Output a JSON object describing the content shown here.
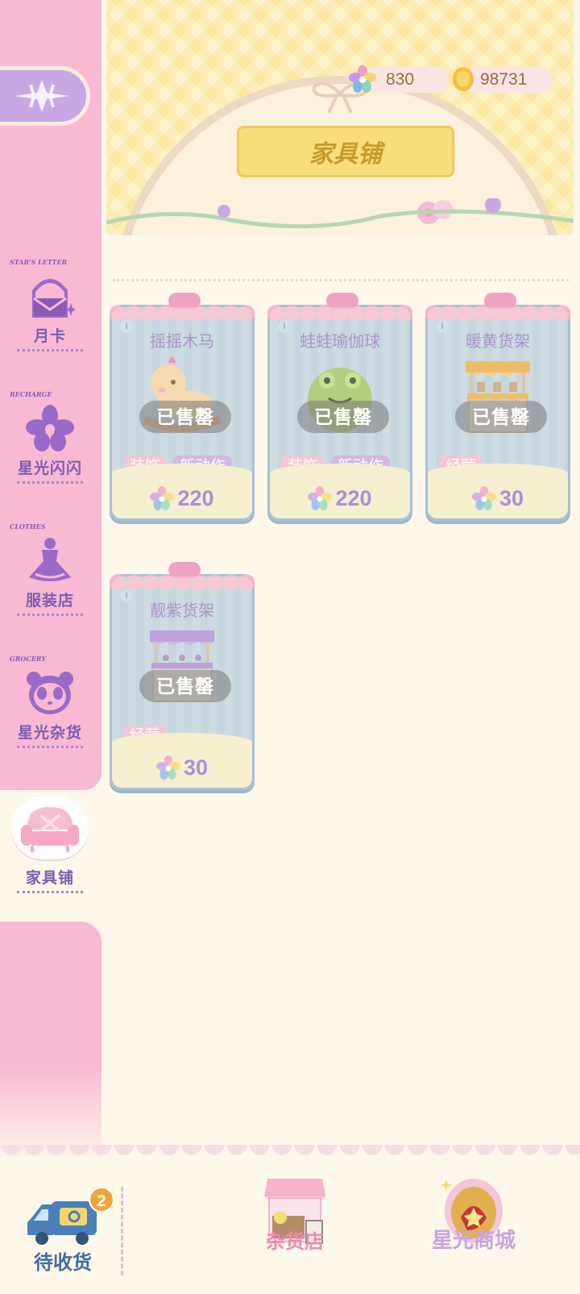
{
  "sidebar": {
    "items": [
      {
        "tag": "STAR'S LETTER",
        "label": "月卡"
      },
      {
        "tag": "RECHARGE",
        "label": "星光闪闪"
      },
      {
        "tag": "CLOTHES",
        "label": "服装店"
      },
      {
        "tag": "GROCERY",
        "label": "星光杂货"
      }
    ],
    "active": {
      "label": "家具铺"
    }
  },
  "header": {
    "title": "家具铺",
    "currency": {
      "star_gems": "830",
      "coins": "98731"
    }
  },
  "products": [
    {
      "name": "摇摇木马",
      "status": "已售罄",
      "tags": [
        "装饰",
        "新动作"
      ],
      "price": "220"
    },
    {
      "name": "蛙蛙瑜伽球",
      "status": "已售罄",
      "tags": [
        "装饰",
        "新动作"
      ],
      "price": "220"
    },
    {
      "name": "暖黄货架",
      "status": "已售罄",
      "tags": [
        "经营"
      ],
      "price": "30"
    },
    {
      "name": "靓紫货架",
      "status": "已售罄",
      "tags": [
        "经营"
      ],
      "price": "30"
    }
  ],
  "bottom_bar": {
    "pending": {
      "label": "待收货",
      "badge": "2"
    },
    "grocery": {
      "label": "杂货店"
    },
    "starlight_mall": {
      "label": "星光商城"
    }
  },
  "colors": {
    "sidebar": "#f9b9d3",
    "background": "#fdf8e9",
    "accent_purple": "#7e5cb0",
    "banner": "#fbe7a0"
  }
}
